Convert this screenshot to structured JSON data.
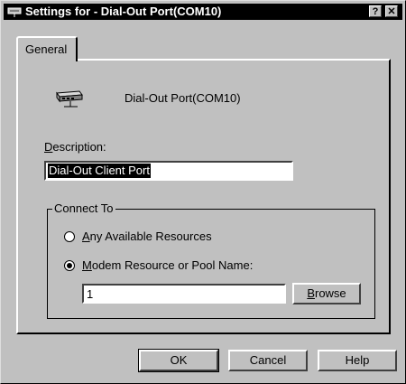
{
  "window": {
    "title": "Settings for - Dial-Out Port(COM10)",
    "help_glyph": "?",
    "close_glyph": "✕",
    "title_icon": "port-icon"
  },
  "tabs": [
    {
      "label": "General",
      "active": true
    }
  ],
  "port": {
    "icon": "network-port-icon",
    "name": "Dial-Out Port(COM10)"
  },
  "description": {
    "label_accel": "D",
    "label_rest": "escription:",
    "value": "Dial-Out Client Port"
  },
  "connect_to": {
    "title": "Connect To",
    "options": [
      {
        "accel": "A",
        "rest": "ny Available Resources",
        "selected": false
      },
      {
        "accel": "M",
        "rest": "odem Resource or Pool Name:",
        "selected": true
      }
    ],
    "pool_value": "1",
    "browse_accel": "B",
    "browse_rest": "rowse"
  },
  "buttons": {
    "ok": "OK",
    "cancel": "Cancel",
    "help": "Help"
  }
}
